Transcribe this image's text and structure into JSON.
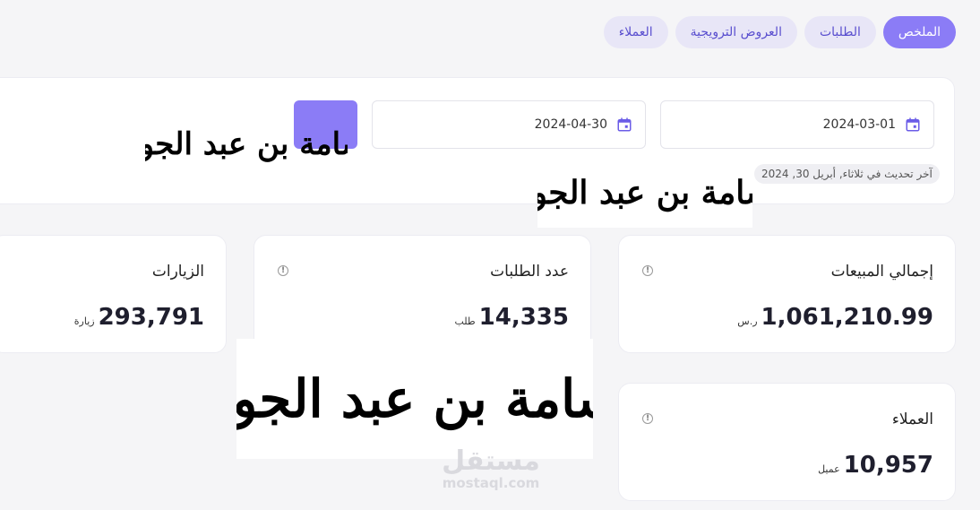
{
  "tabs": [
    {
      "label": "الملخص",
      "active": true
    },
    {
      "label": "الطلبات",
      "active": false
    },
    {
      "label": "العروض الترويجية",
      "active": false
    },
    {
      "label": "العملاء",
      "active": false
    }
  ],
  "filters": {
    "start_date": "2024-03-01",
    "end_date": "2024-04-30",
    "last_updated": "آخر تحديث في ثلاثاء, أبريل 30, 2024"
  },
  "stats": {
    "sales": {
      "title": "إجمالي المبيعات",
      "value": "1,061,210.99",
      "unit": "ر.س"
    },
    "orders": {
      "title": "عدد الطلبات",
      "value": "14,335",
      "unit": "طلب"
    },
    "visits": {
      "title": "الزيارات",
      "value": "293,791",
      "unit": "زيارة"
    },
    "customers": {
      "title": "العملاء",
      "value": "10,957",
      "unit": "عميل"
    }
  },
  "overlay": {
    "calligraphy": "أسامة بن عبد الجواد",
    "watermark_ar": "مستقل",
    "watermark_en": "mostaql.com"
  },
  "colors": {
    "accent": "#8b7cf6",
    "tab_bg": "#e8e6f7",
    "background": "#f5f5f7"
  },
  "icons": [
    "calendar-icon",
    "info-icon"
  ]
}
